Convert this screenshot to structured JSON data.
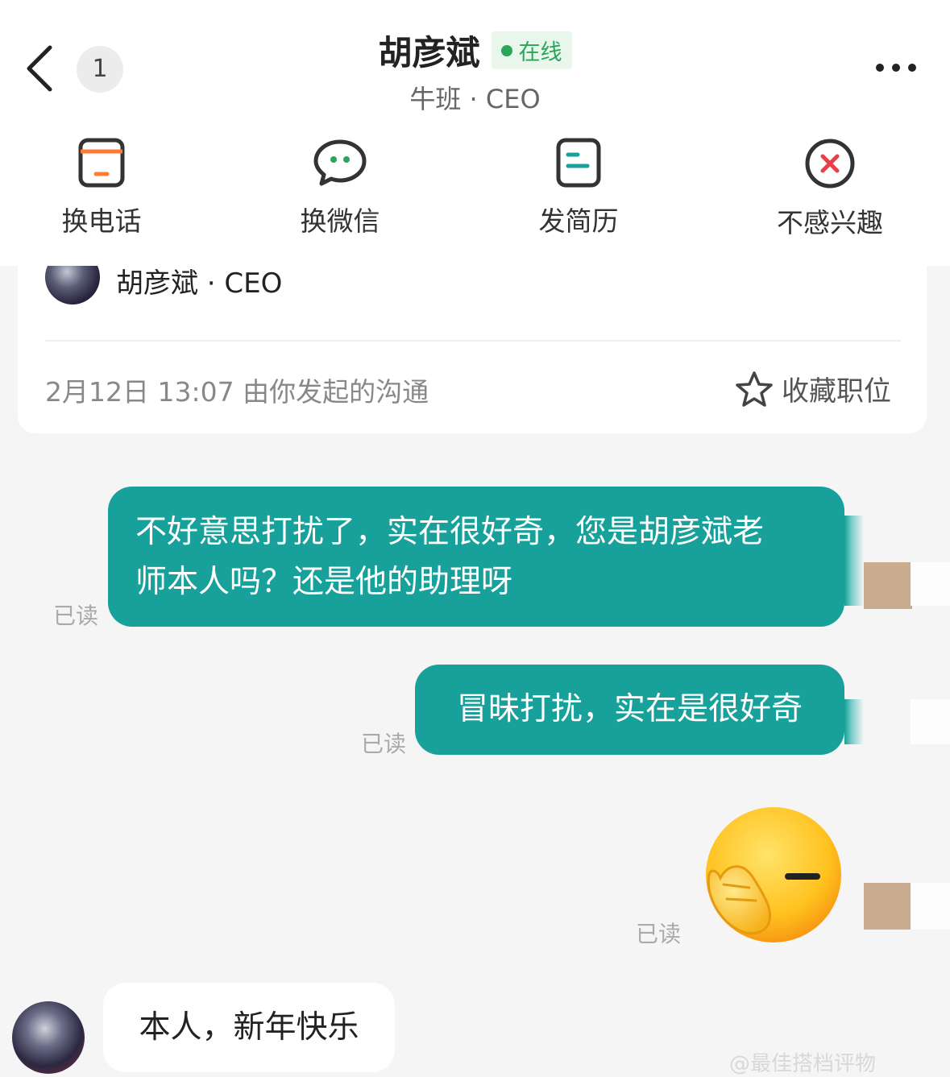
{
  "header": {
    "unread_count": "1",
    "name": "胡彦斌",
    "status": "在线",
    "subtitle": "牛班 · CEO"
  },
  "actions": [
    {
      "label": "换电话",
      "icon": "phone-icon"
    },
    {
      "label": "换微信",
      "icon": "wechat-icon"
    },
    {
      "label": "发简历",
      "icon": "resume-icon"
    },
    {
      "label": "不感兴趣",
      "icon": "not-interested-icon"
    }
  ],
  "card": {
    "name": "胡彦斌 · CEO",
    "time": "2月12日 13:07 由你发起的沟通",
    "favorite_label": "收藏职位"
  },
  "messages": [
    {
      "from": "me",
      "lines": [
        "不好意思打扰了，实在很好奇，您是胡彦斌老",
        "师本人吗？还是他的助理呀"
      ],
      "status": "已读"
    },
    {
      "from": "me",
      "text": "冒昧打扰，实在是很好奇",
      "status": "已读"
    },
    {
      "from": "me",
      "emoji": "facepalm-emoji",
      "status": "已读"
    },
    {
      "from": "other",
      "text": "本人，新年快乐"
    }
  ],
  "watermark": "@最佳搭档评物",
  "colors": {
    "accent": "#17a19a",
    "online": "#2aa55a",
    "close_red": "#e8404a",
    "icon_orange": "#ff7a35"
  }
}
